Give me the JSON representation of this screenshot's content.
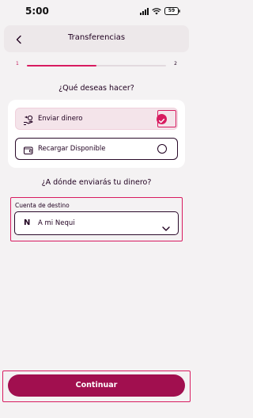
{
  "status_bar": {
    "time": "5:00",
    "battery": "59"
  },
  "header": {
    "title": "Transferencias",
    "back_icon": "chevron-left-icon"
  },
  "progress": {
    "step_current": "1",
    "step_total": "2",
    "fill_fraction": 0.5
  },
  "section_action": {
    "question": "¿Qué deseas hacer?",
    "options": [
      {
        "label": "Enviar dinero",
        "icon": "send-money-icon",
        "selected": true
      },
      {
        "label": "Recargar Disponible",
        "icon": "wallet-icon",
        "selected": false
      }
    ]
  },
  "section_destination": {
    "question": "¿A dónde enviarás tu dinero?",
    "field_label": "Cuenta de destino",
    "selected_value": "A mi Nequi",
    "value_icon_letter": "N"
  },
  "footer": {
    "continue_label": "Continuar"
  },
  "colors": {
    "accent": "#d81b60",
    "primary_button": "#a10f4f",
    "background": "#f4f2f3"
  }
}
